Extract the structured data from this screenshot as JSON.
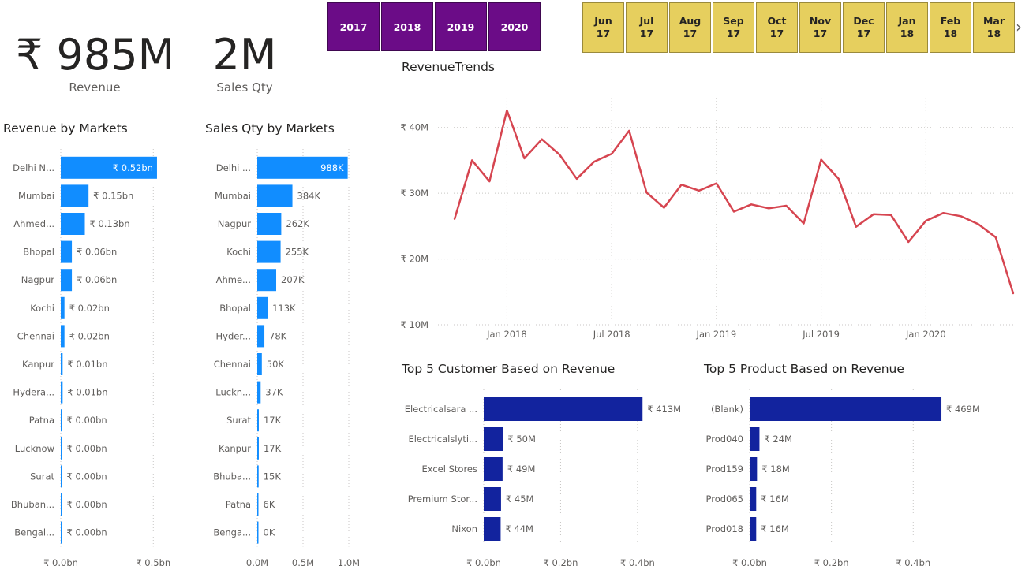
{
  "kpis": {
    "revenue_value": "₹ 985M",
    "revenue_label": "Revenue",
    "qty_value": "2M",
    "qty_label": "Sales Qty"
  },
  "year_slicer": [
    "2017",
    "2018",
    "2019",
    "2020"
  ],
  "month_slicer": [
    {
      "m": "Jun",
      "y": "17"
    },
    {
      "m": "Jul",
      "y": "17"
    },
    {
      "m": "Aug",
      "y": "17"
    },
    {
      "m": "Sep",
      "y": "17"
    },
    {
      "m": "Oct",
      "y": "17"
    },
    {
      "m": "Nov",
      "y": "17"
    },
    {
      "m": "Dec",
      "y": "17"
    },
    {
      "m": "Jan",
      "y": "18"
    },
    {
      "m": "Feb",
      "y": "18"
    },
    {
      "m": "Mar",
      "y": "18"
    }
  ],
  "titles": {
    "revenue_markets": "Revenue by Markets",
    "qty_markets": "Sales Qty by Markets",
    "trend": "RevenueTrends",
    "top_customers": "Top 5 Customer Based on Revenue",
    "top_products": "Top 5 Product Based on Revenue"
  },
  "colors": {
    "market_bar": "#118dff",
    "top5_bar": "#12239e",
    "trend_line": "#d64550",
    "year_tile": "#6b0c87",
    "month_tile": "#e6cf5e"
  },
  "chart_data": [
    {
      "id": "revenue_by_markets",
      "type": "bar",
      "orientation": "horizontal",
      "title": "Revenue by Markets",
      "categories": [
        "Delhi N...",
        "Mumbai",
        "Ahmed...",
        "Bhopal",
        "Nagpur",
        "Kochi",
        "Chennai",
        "Kanpur",
        "Hydera...",
        "Patna",
        "Lucknow",
        "Surat",
        "Bhuban...",
        "Bengal..."
      ],
      "values": [
        0.52,
        0.15,
        0.13,
        0.06,
        0.06,
        0.02,
        0.02,
        0.01,
        0.01,
        0.003,
        0.002,
        0.002,
        0.001,
        0.0005
      ],
      "labels": [
        "₹ 0.52bn",
        "₹ 0.15bn",
        "₹ 0.13bn",
        "₹ 0.06bn",
        "₹ 0.06bn",
        "₹ 0.02bn",
        "₹ 0.02bn",
        "₹ 0.01bn",
        "₹ 0.01bn",
        "₹ 0.00bn",
        "₹ 0.00bn",
        "₹ 0.00bn",
        "₹ 0.00bn",
        "₹ 0.00bn"
      ],
      "ticks": [
        0,
        0.5
      ],
      "tick_labels": [
        "₹ 0.0bn",
        "₹ 0.5bn"
      ],
      "xlim": [
        0,
        0.55
      ]
    },
    {
      "id": "qty_by_markets",
      "type": "bar",
      "orientation": "horizontal",
      "title": "Sales Qty by Markets",
      "categories": [
        "Delhi ...",
        "Mumbai",
        "Nagpur",
        "Kochi",
        "Ahme...",
        "Bhopal",
        "Hyder...",
        "Chennai",
        "Luckn...",
        "Surat",
        "Kanpur",
        "Bhuba...",
        "Patna",
        "Benga..."
      ],
      "values": [
        988,
        384,
        262,
        255,
        207,
        113,
        78,
        50,
        37,
        17,
        17,
        15,
        6,
        0.4
      ],
      "labels": [
        "988K",
        "384K",
        "262K",
        "255K",
        "207K",
        "113K",
        "78K",
        "50K",
        "37K",
        "17K",
        "17K",
        "15K",
        "6K",
        "0K"
      ],
      "ticks": [
        0,
        500,
        1000
      ],
      "tick_labels": [
        "0.0M",
        "0.5M",
        "1.0M"
      ],
      "xlim": [
        0,
        1000
      ]
    },
    {
      "id": "revenue_trend",
      "type": "line",
      "title": "RevenueTrends",
      "x": [
        "2017-10",
        "2017-11",
        "2017-12",
        "2018-01",
        "2018-02",
        "2018-03",
        "2018-04",
        "2018-05",
        "2018-06",
        "2018-07",
        "2018-08",
        "2018-09",
        "2018-10",
        "2018-11",
        "2018-12",
        "2019-01",
        "2019-02",
        "2019-03",
        "2019-04",
        "2019-05",
        "2019-06",
        "2019-07",
        "2019-08",
        "2019-09",
        "2019-10",
        "2019-11",
        "2019-12",
        "2020-01",
        "2020-02",
        "2020-03",
        "2020-04",
        "2020-05",
        "2020-06"
      ],
      "y": [
        26.1,
        35.0,
        31.8,
        42.6,
        35.3,
        38.2,
        35.9,
        32.2,
        34.8,
        36.0,
        39.5,
        30.1,
        27.8,
        31.3,
        30.4,
        31.5,
        27.2,
        28.3,
        27.7,
        28.1,
        25.4,
        35.1,
        32.2,
        24.9,
        26.8,
        26.7,
        22.6,
        25.8,
        27.0,
        26.5,
        25.3,
        23.3,
        14.8
      ],
      "y_ticks": [
        10,
        20,
        30,
        40
      ],
      "y_tick_labels": [
        "₹ 10M",
        "₹ 20M",
        "₹ 30M",
        "₹ 40M"
      ],
      "x_ticks": [
        "2018-01",
        "2018-07",
        "2019-01",
        "2019-07",
        "2020-01"
      ],
      "x_tick_labels": [
        "Jan 2018",
        "Jul 2018",
        "Jan 2019",
        "Jul 2019",
        "Jan 2020"
      ],
      "ylim": [
        10,
        45
      ],
      "grid": true
    },
    {
      "id": "top_customers",
      "type": "bar",
      "orientation": "horizontal",
      "title": "Top 5 Customer Based on Revenue",
      "categories": [
        "Electricalsara ...",
        "Electricalslyti...",
        "Excel Stores",
        "Premium Stor...",
        "Nixon"
      ],
      "values": [
        0.413,
        0.05,
        0.049,
        0.045,
        0.044
      ],
      "labels": [
        "₹ 413M",
        "₹ 50M",
        "₹ 49M",
        "₹ 45M",
        "₹ 44M"
      ],
      "ticks": [
        0,
        0.2,
        0.4
      ],
      "tick_labels": [
        "₹ 0.0bn",
        "₹ 0.2bn",
        "₹ 0.4bn"
      ],
      "xlim": [
        0,
        0.55
      ]
    },
    {
      "id": "top_products",
      "type": "bar",
      "orientation": "horizontal",
      "title": "Top 5 Product Based on Revenue",
      "categories": [
        "(Blank)",
        "Prod040",
        "Prod159",
        "Prod065",
        "Prod018"
      ],
      "values": [
        0.469,
        0.024,
        0.018,
        0.016,
        0.016
      ],
      "labels": [
        "₹ 469M",
        "₹ 24M",
        "₹ 18M",
        "₹ 16M",
        "₹ 16M"
      ],
      "ticks": [
        0,
        0.2,
        0.4
      ],
      "tick_labels": [
        "₹ 0.0bn",
        "₹ 0.2bn",
        "₹ 0.4bn"
      ],
      "xlim": [
        0,
        0.55
      ]
    }
  ]
}
